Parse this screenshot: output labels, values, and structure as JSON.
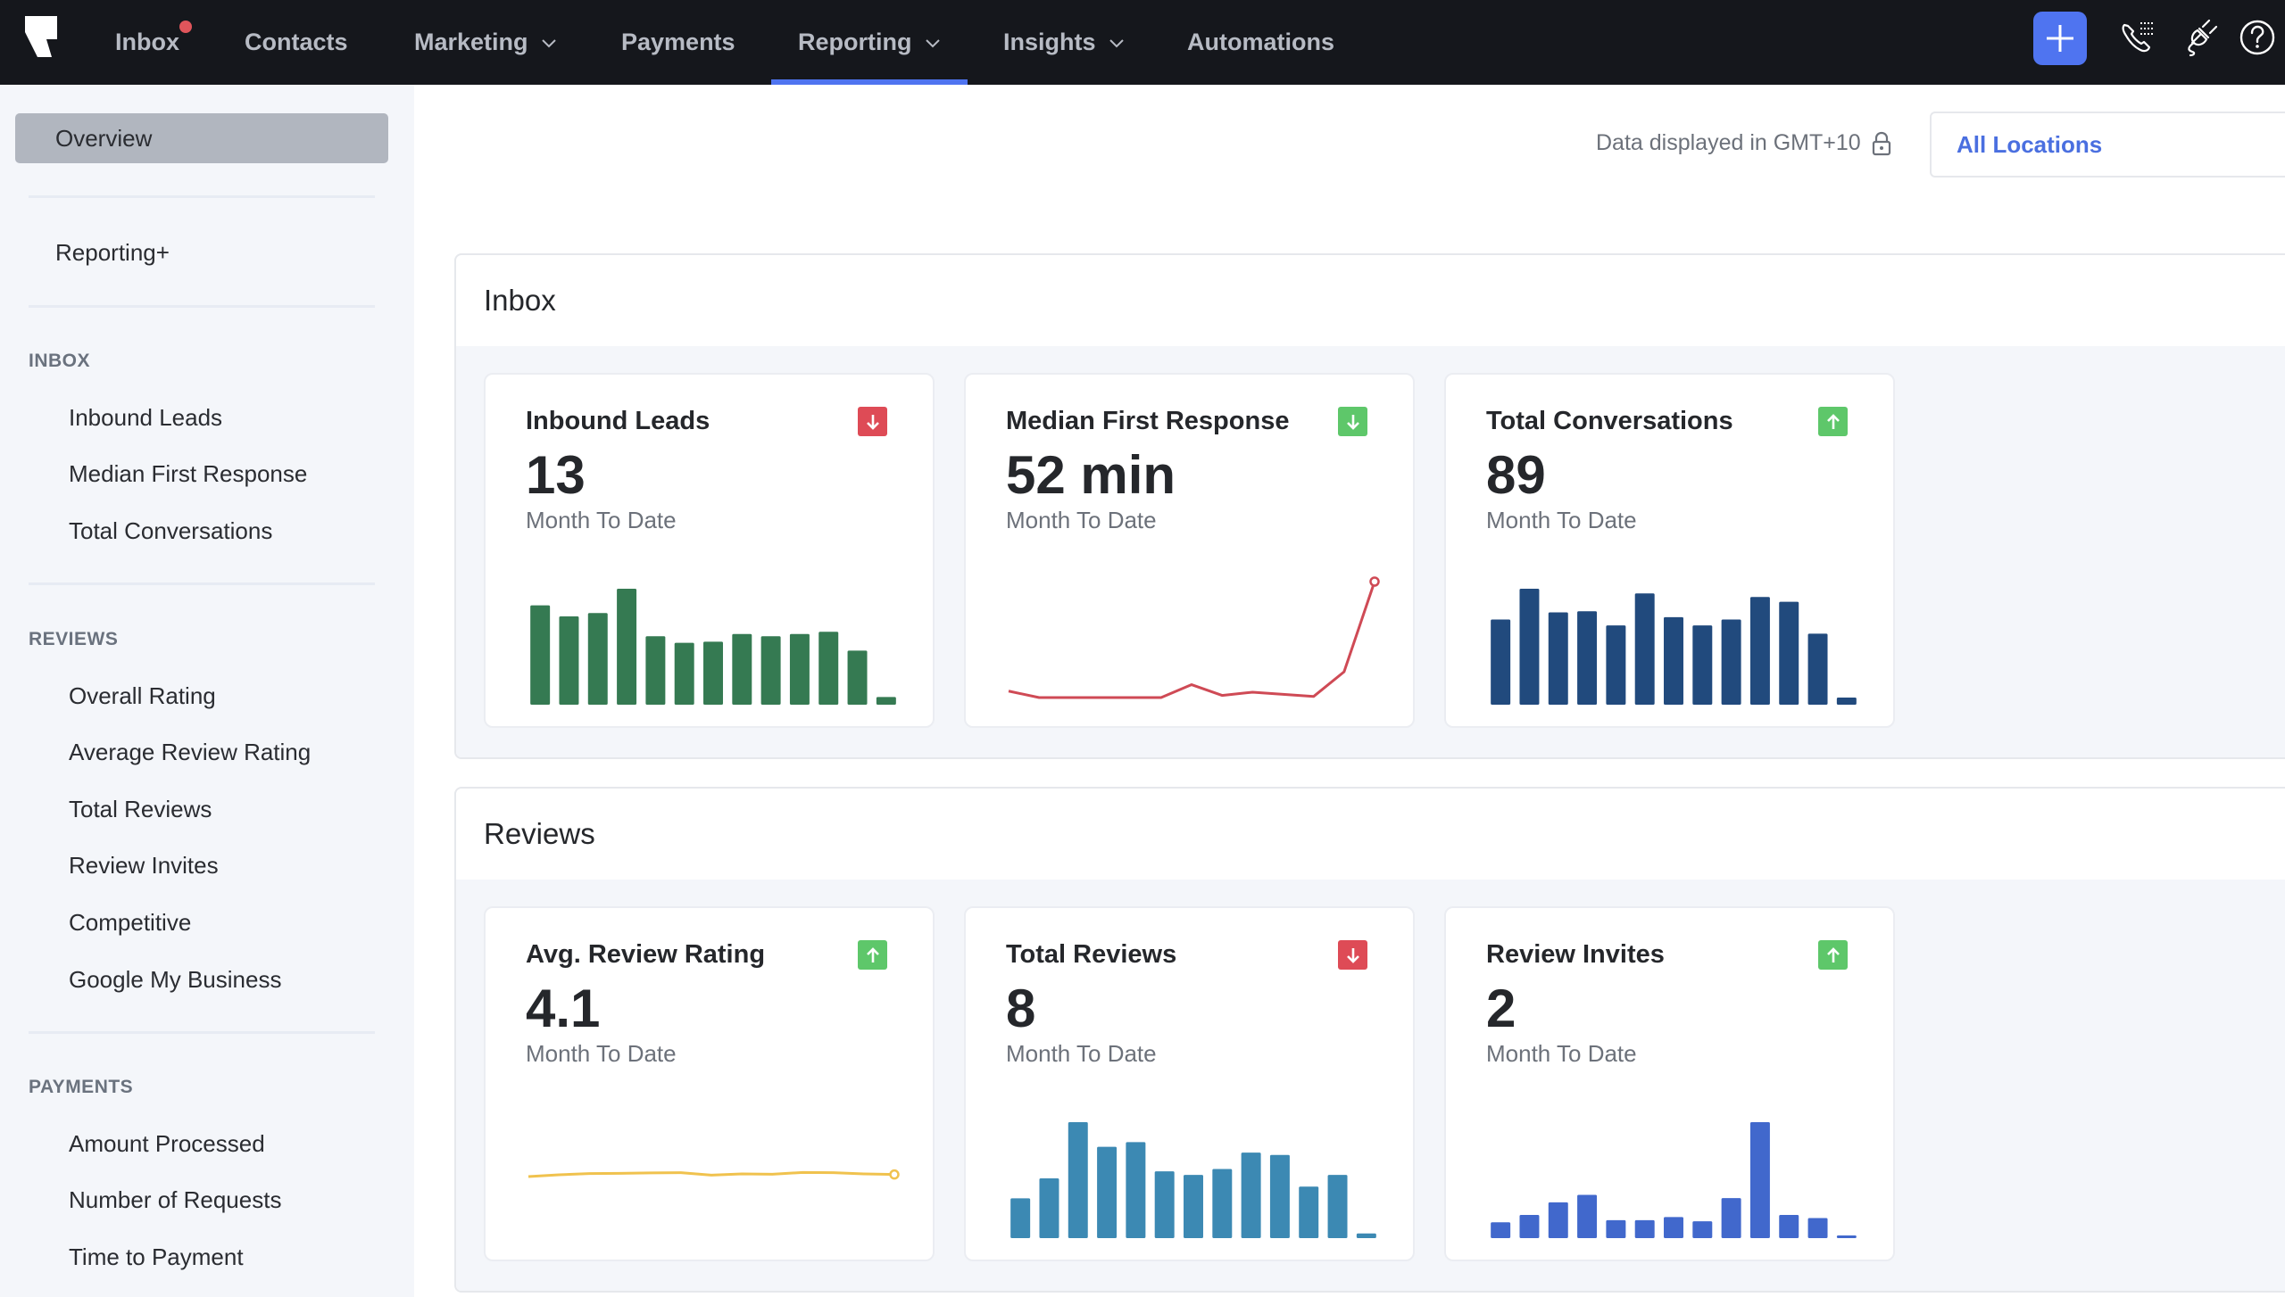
{
  "nav": {
    "items": [
      {
        "label": "Inbox",
        "has_dropdown": false,
        "notification": true
      },
      {
        "label": "Contacts",
        "has_dropdown": false
      },
      {
        "label": "Marketing",
        "has_dropdown": true
      },
      {
        "label": "Payments",
        "has_dropdown": false
      },
      {
        "label": "Reporting",
        "has_dropdown": true,
        "active": true
      },
      {
        "label": "Insights",
        "has_dropdown": true
      },
      {
        "label": "Automations",
        "has_dropdown": false
      }
    ],
    "icons": [
      "logo-icon",
      "plus-icon",
      "call-list-icon",
      "plug-icon",
      "help-icon"
    ],
    "accent": "#4f74f0"
  },
  "sidebar": {
    "overview": "Overview",
    "reporting_plus": "Reporting+",
    "sections": [
      {
        "heading": "INBOX",
        "items": [
          "Inbound Leads",
          "Median First Response",
          "Total Conversations"
        ]
      },
      {
        "heading": "REVIEWS",
        "items": [
          "Overall Rating",
          "Average Review Rating",
          "Total Reviews",
          "Review Invites",
          "Competitive",
          "Google My Business"
        ]
      },
      {
        "heading": "PAYMENTS",
        "items": [
          "Amount Processed",
          "Number of Requests",
          "Time to Payment"
        ]
      }
    ]
  },
  "header": {
    "timezone_label": "Data displayed in GMT+10",
    "location_select": "All Locations"
  },
  "panels": [
    {
      "title": "Inbox",
      "cards": [
        {
          "title": "Inbound Leads",
          "value": "13",
          "period": "Month To Date",
          "trend": "down",
          "trend_color": "#de4b56",
          "chart": "bar",
          "color": "#357a52",
          "series": [
            90,
            80,
            83,
            105,
            62,
            56,
            57,
            64,
            62,
            64,
            66,
            49,
            7
          ]
        },
        {
          "title": "Median First Response",
          "value": "52 min",
          "period": "Month To Date",
          "trend": "down",
          "trend_color": "#5ec76a",
          "chart": "line",
          "color": "#cf4a55",
          "series": [
            10,
            4,
            4,
            4,
            4,
            4,
            16,
            6,
            9,
            7,
            5,
            28,
            112
          ]
        },
        {
          "title": "Total Conversations",
          "value": "89",
          "period": "Month To Date",
          "trend": "up",
          "trend_color": "#5ec76a",
          "chart": "bar",
          "color": "#214a7d",
          "series": [
            72,
            98,
            78,
            79,
            67,
            94,
            74,
            67,
            72,
            91,
            87,
            60,
            6
          ]
        }
      ]
    },
    {
      "title": "Reviews",
      "cards": [
        {
          "title": "Avg. Review Rating",
          "value": "4.1",
          "period": "Month To Date",
          "trend": "up",
          "trend_color": "#5ec76a",
          "chart": "line",
          "color": "#f0c24e",
          "series": [
            3.9,
            4.02,
            4.1,
            4.12,
            4.15,
            4.16,
            4.0,
            4.08,
            4.06,
            4.18,
            4.16,
            4.08,
            4.04
          ]
        },
        {
          "title": "Total Reviews",
          "value": "8",
          "period": "Month To Date",
          "trend": "down",
          "trend_color": "#de4b56",
          "chart": "bar",
          "color": "#3c89b3",
          "series": [
            34,
            51,
            99,
            78,
            82,
            57,
            54,
            59,
            73,
            71,
            44,
            54,
            4
          ]
        },
        {
          "title": "Review Invites",
          "value": "2",
          "period": "Month To Date",
          "trend": "up",
          "trend_color": "#5ec76a",
          "chart": "bar",
          "color": "#4168cc",
          "series": [
            15,
            22,
            34,
            41,
            17,
            17,
            20,
            16,
            38,
            110,
            22,
            19,
            2
          ]
        }
      ]
    }
  ]
}
